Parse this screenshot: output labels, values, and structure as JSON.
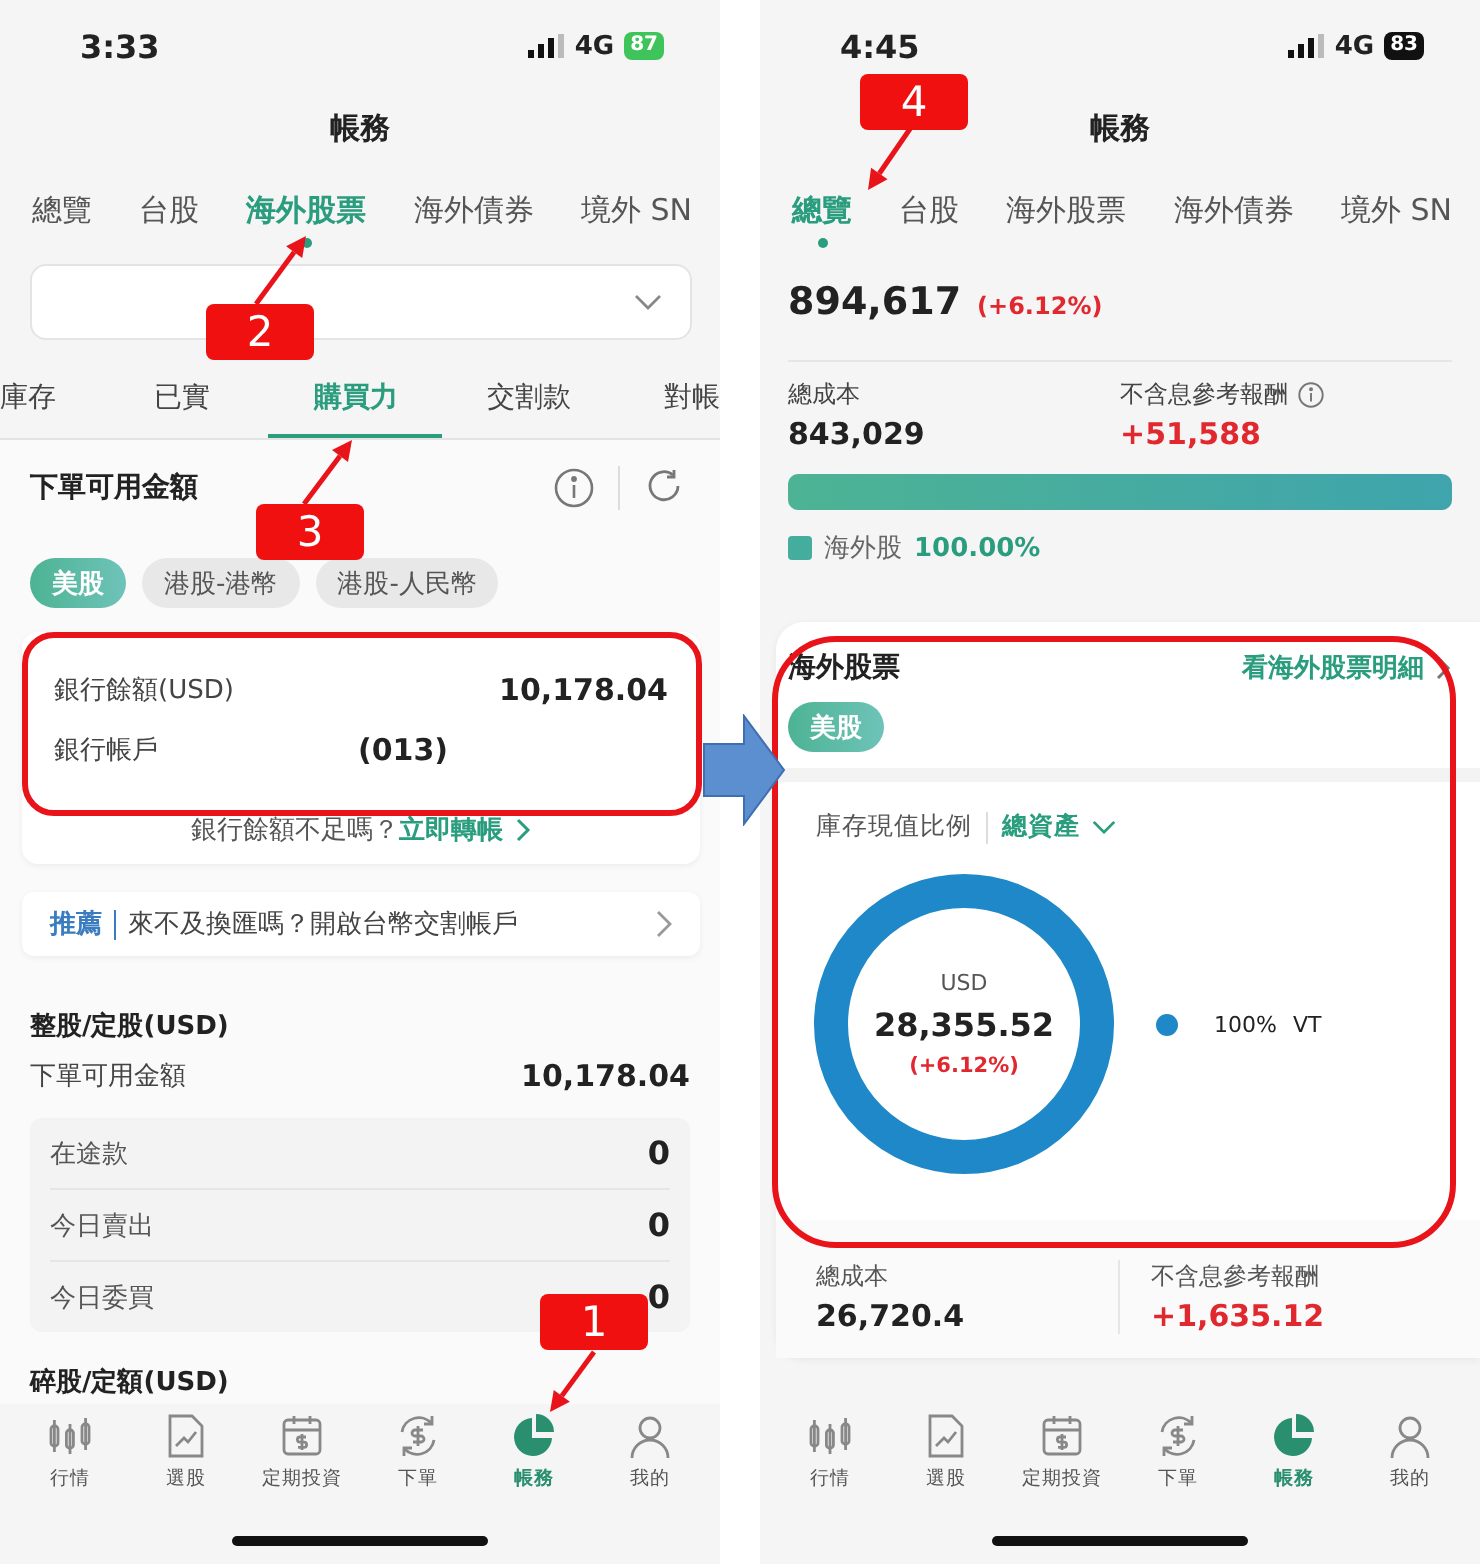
{
  "screens": [
    {
      "kind": "buying-power",
      "status": {
        "time": "3:33",
        "network": "4G",
        "battery": "87",
        "charging": true
      },
      "title": "帳務",
      "tabs": [
        {
          "label": "總覽",
          "selected": false
        },
        {
          "label": "台股",
          "selected": false
        },
        {
          "label": "海外股票",
          "selected": true
        },
        {
          "label": "海外債券",
          "selected": false
        },
        {
          "label": "境外 SN",
          "selected": false
        }
      ],
      "sub_tabs": [
        {
          "label": "庫存",
          "selected": false
        },
        {
          "label": "已實",
          "selected": false
        },
        {
          "label": "購買力",
          "selected": true
        },
        {
          "label": "交割款",
          "selected": false
        },
        {
          "label": "對帳",
          "selected": false
        }
      ],
      "section_title": "下單可用金額",
      "currency_chips": [
        {
          "label": "美股",
          "selected": true
        },
        {
          "label": "港股-港幣",
          "selected": false
        },
        {
          "label": "港股-人民幣",
          "selected": false
        }
      ],
      "bank_card": {
        "rows": [
          {
            "label": "銀行餘額(USD)",
            "value": "10,178.04"
          },
          {
            "label": "銀行帳戶",
            "value": "(013)"
          }
        ],
        "prompt": "銀行餘額不足嗎？",
        "link": "立即轉帳"
      },
      "promo": {
        "tag": "推薦",
        "text": "來不及換匯嗎？開啟台幣交割帳戶"
      },
      "whole_shares": {
        "title": "整股/定股(USD)",
        "label": "下單可用金額",
        "value": "10,178.04",
        "details": [
          {
            "label": "在途款",
            "value": "0"
          },
          {
            "label": "今日賣出",
            "value": "0"
          },
          {
            "label": "今日委買",
            "value": "0"
          }
        ]
      },
      "fractional": {
        "title": "碎股/定額(USD)"
      },
      "nav": [
        {
          "label": "行情",
          "selected": false
        },
        {
          "label": "選股",
          "selected": false
        },
        {
          "label": "定期投資",
          "selected": false
        },
        {
          "label": "下單",
          "selected": false
        },
        {
          "label": "帳務",
          "selected": true
        },
        {
          "label": "我的",
          "selected": false
        }
      ]
    },
    {
      "kind": "overview",
      "status": {
        "time": "4:45",
        "network": "4G",
        "battery": "83",
        "charging": false
      },
      "title": "帳務",
      "tabs": [
        {
          "label": "總覽",
          "selected": true
        },
        {
          "label": "台股",
          "selected": false
        },
        {
          "label": "海外股票",
          "selected": false
        },
        {
          "label": "海外債券",
          "selected": false
        },
        {
          "label": "境外 SN",
          "selected": false
        }
      ],
      "total": {
        "value": "894,617",
        "change": "(+6.12%)"
      },
      "stats": [
        {
          "label": "總成本",
          "value": "843,029",
          "kind": "plain",
          "info": false
        },
        {
          "label": "不含息參考報酬",
          "value": "+51,588",
          "kind": "gain",
          "info": true
        }
      ],
      "allocation": {
        "level": 1,
        "label": "海外股",
        "share": "100.00%"
      },
      "holdings_card": {
        "title": "海外股票",
        "link": "看海外股票明細",
        "chips": [
          {
            "label": "美股",
            "selected": true
          }
        ],
        "ratio_label": "庫存現值比例",
        "ratio_filter": "總資產",
        "donut": {
          "currency": "USD",
          "value": "28,355.52",
          "change": "(+6.12%)"
        },
        "legend": [
          {
            "share": "100%",
            "name": "VT",
            "color": "#1e88c8"
          }
        ],
        "stats": [
          {
            "label": "總成本",
            "value": "26,720.4",
            "kind": "plain"
          },
          {
            "label": "不含息參考報酬",
            "value": "+1,635.12",
            "kind": "gain"
          }
        ]
      },
      "nav": [
        {
          "label": "行情",
          "selected": false
        },
        {
          "label": "選股",
          "selected": false
        },
        {
          "label": "定期投資",
          "selected": false
        },
        {
          "label": "下單",
          "selected": false
        },
        {
          "label": "帳務",
          "selected": true
        },
        {
          "label": "我的",
          "selected": false
        }
      ]
    }
  ],
  "markers": [
    {
      "label": "1"
    },
    {
      "label": "2"
    },
    {
      "label": "3"
    },
    {
      "label": "4"
    }
  ]
}
